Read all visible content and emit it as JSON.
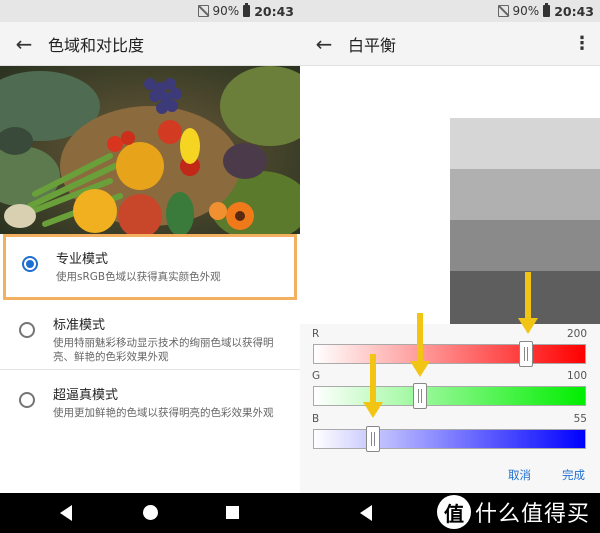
{
  "status_bar": {
    "battery": "90%",
    "time": "20:43"
  },
  "left_screen": {
    "title": "色域和对比度",
    "options": [
      {
        "title": "专业模式",
        "desc": "使用sRGB色域以获得真实颜色外观",
        "selected": true,
        "highlighted": true
      },
      {
        "title": "标准模式",
        "desc": "使用特丽魅彩移动显示技术的绚丽色域以获得明亮、鲜艳的色彩效果外观",
        "selected": false,
        "highlighted": false
      },
      {
        "title": "超逼真模式",
        "desc": "使用更加鲜艳的色域以获得明亮的色彩效果外观",
        "selected": false,
        "highlighted": false
      }
    ]
  },
  "right_screen": {
    "title": "白平衡",
    "sliders": [
      {
        "label": "R",
        "value": "200",
        "level": 0.784,
        "color": "#ff0000"
      },
      {
        "label": "G",
        "value": "100",
        "level": 0.392,
        "color": "#00ee00"
      },
      {
        "label": "B",
        "value": "55",
        "level": 0.216,
        "color": "#0000ff"
      }
    ],
    "cancel_label": "取消",
    "done_label": "完成",
    "swatch_colors": [
      "#d6d6d6",
      "#b0b0b0",
      "#8a8a8a",
      "#5e5e5e"
    ]
  },
  "watermark": {
    "glyph": "值",
    "text": "什么值得买"
  }
}
